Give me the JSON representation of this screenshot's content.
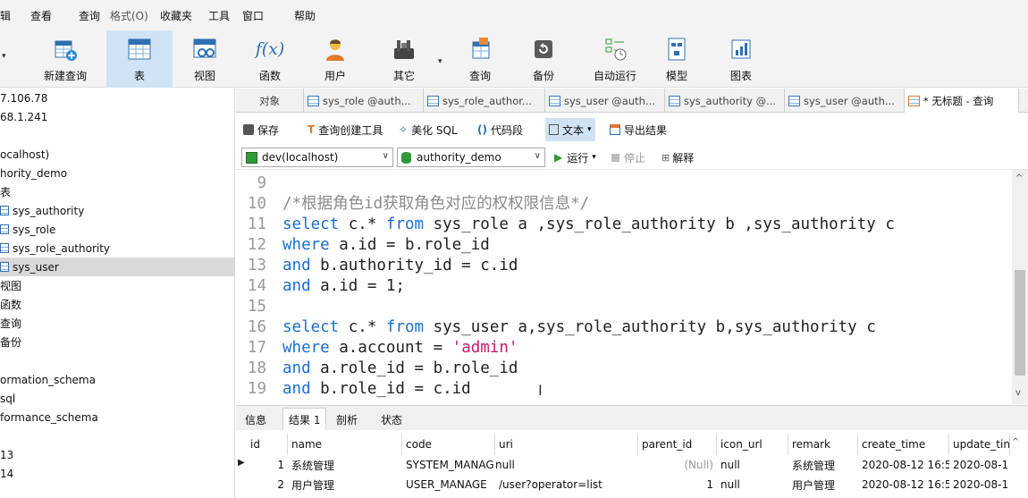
{
  "menubar": {
    "items": [
      "辑",
      "查看",
      "查询",
      "格式(O)",
      "收藏夹",
      "工具",
      "窗口",
      "帮助"
    ]
  },
  "toolbar": {
    "new_query": "新建查询",
    "table": "表",
    "view": "视图",
    "function": "函数",
    "user": "用户",
    "other": "其它",
    "query": "查询",
    "backup": "备份",
    "automation": "自动运行",
    "model": "模型",
    "chart": "图表",
    "function_icon_text": "f(x)"
  },
  "tree": {
    "items": [
      "7.106.78",
      "68.1.241",
      "",
      "ocalhost)",
      "hority_demo",
      "表",
      "sys_authority",
      "sys_role",
      "sys_role_authority",
      "sys_user",
      "视图",
      "函数",
      "查询",
      "备份",
      "",
      "ormation_schema",
      "sql",
      "formance_schema",
      "",
      "13",
      "14"
    ]
  },
  "tabs": {
    "object": "对象",
    "items": [
      "sys_role @auth...",
      "sys_role_author...",
      "sys_user @auth...",
      "sys_authority @...",
      "sys_user @auth...",
      "* 无标题 - 查询"
    ]
  },
  "editor_toolbar": {
    "save": "保存",
    "query_builder": "查询创建工具",
    "beautify": "美化 SQL",
    "snippet": "代码段",
    "text": "文本",
    "export": "导出结果",
    "connection": "dev(localhost)",
    "database": "authority_demo",
    "run": "运行",
    "stop": "停止",
    "explain": "解释"
  },
  "code": {
    "lines": [
      {
        "n": "9"
      },
      {
        "n": "10",
        "comment": "/*根据角色id获取角色对应的权权限信息*/"
      },
      {
        "n": "11",
        "k1": "select",
        "t1": " c.* ",
        "k2": "from",
        "t2": " sys_role a ,sys_role_authority b ,sys_authority c"
      },
      {
        "n": "12",
        "k1": "where",
        "t1": " a.id = b.role_id"
      },
      {
        "n": "13",
        "k1": "and",
        "t1": " b.authority_id = c.id"
      },
      {
        "n": "14",
        "k1": "and",
        "t1": " a.id = 1;"
      },
      {
        "n": "15"
      },
      {
        "n": "16",
        "k1": "select",
        "t1": " c.* ",
        "k2": "from",
        "t2": " sys_user a,sys_role_authority b,sys_authority c"
      },
      {
        "n": "17",
        "k1": "where",
        "t1": " a.account = ",
        "s1": "'admin'"
      },
      {
        "n": "18",
        "k1": "and",
        "t1": " a.role_id = b.role_id"
      },
      {
        "n": "19",
        "k1": "and",
        "t1": " b.role_id = c.id"
      }
    ]
  },
  "result_tabs": {
    "info": "信息",
    "result1": "结果 1",
    "profile": "剖析",
    "status": "状态"
  },
  "grid": {
    "columns": [
      "id",
      "name",
      "code",
      "uri",
      "parent_id",
      "icon_url",
      "remark",
      "create_time",
      "update_tin"
    ],
    "rows": [
      [
        "1",
        "系统管理",
        "SYSTEM_MANAG",
        "null",
        "(Null)",
        "null",
        "系统管理",
        "2020-08-12 16:5",
        "2020-08-1"
      ],
      [
        "2",
        "用户管理",
        "USER_MANAGE",
        "/user?operator=list",
        "1",
        "null",
        "用户管理",
        "2020-08-12 16:5",
        "2020-08-1"
      ]
    ]
  },
  "colors": {
    "keyword": "#1a6fcf",
    "string": "#c41a6e",
    "comment": "#8a8a8a",
    "selection": "#cfe3f5"
  }
}
